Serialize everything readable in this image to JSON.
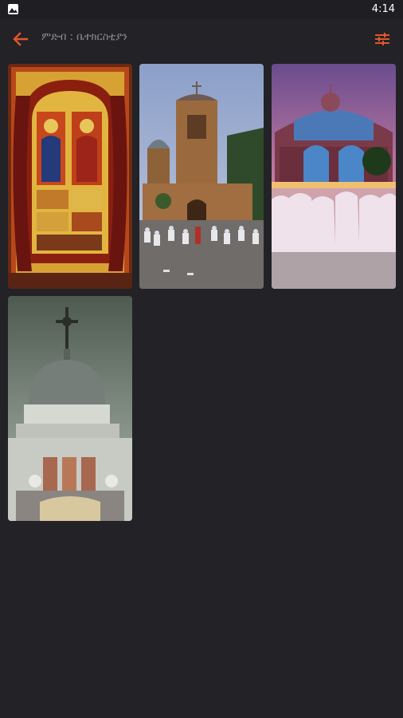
{
  "status_bar": {
    "time": "4:14",
    "left_icon": "image-icon"
  },
  "app_bar": {
    "back_icon": "arrow-left-icon",
    "title": "ምድብ : ቤተክርስቲያን",
    "filter_icon": "sliders-icon",
    "accent_color": "#e0572b"
  },
  "gallery": {
    "items": [
      {
        "name": "icon-painting-photo"
      },
      {
        "name": "stone-church-photo"
      },
      {
        "name": "domed-cathedral-night-photo"
      },
      {
        "name": "church-dome-cross-photo"
      }
    ]
  }
}
